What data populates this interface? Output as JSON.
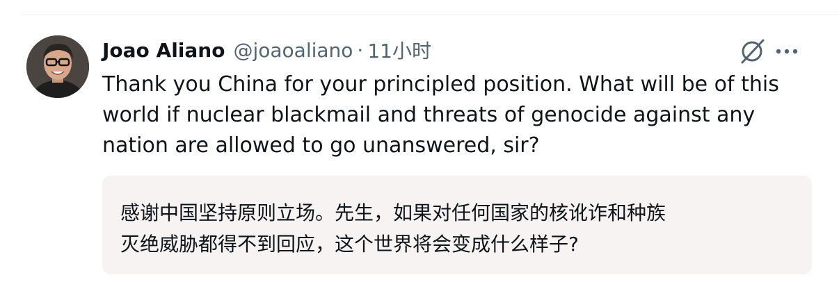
{
  "tweet": {
    "author": {
      "display_name": "Joao Aliano",
      "handle": "@joaoaliano",
      "avatar_icon": "person-photo-avatar"
    },
    "separator": "·",
    "time": "11小时",
    "text": "Thank you China for your principled position. What will be of this\nworld if nuclear blackmail and threats of genocide against any\nnation are allowed to go unanswered, sir?",
    "translation": {
      "text": "感谢中国坚持原则立场。先生，如果对任何国家的核讹诈和种族\n灭绝威胁都得不到回应，这个世界将会变成什么样子?"
    },
    "actions": {
      "grok_icon": "grok-icon",
      "more_icon": "more-options-icon"
    }
  },
  "colors": {
    "text_primary": "#0f1419",
    "text_secondary": "#536471",
    "translation_bg": "#f7f3f3"
  }
}
